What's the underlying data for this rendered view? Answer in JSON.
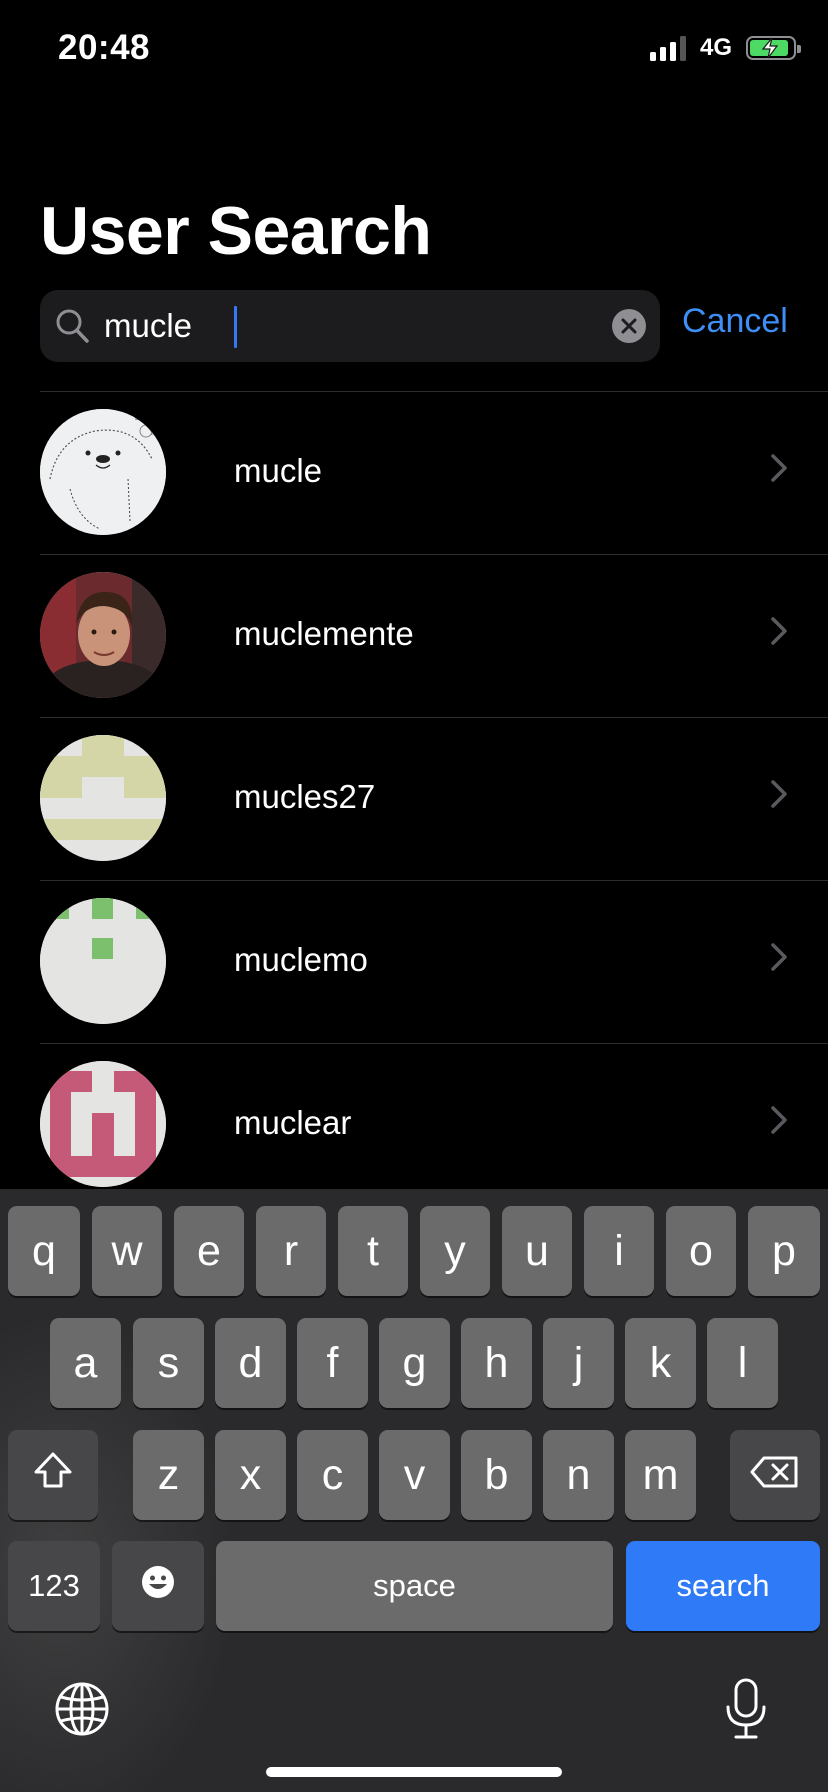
{
  "status_bar": {
    "time": "20:48",
    "network": "4G",
    "signal_icon": "cellular-signal-icon",
    "battery_icon": "battery-charging-icon"
  },
  "page": {
    "title": "User Search"
  },
  "search": {
    "value": "mucle",
    "cancel_label": "Cancel",
    "clear_icon": "clear-icon",
    "search_icon": "magnifier-icon"
  },
  "results": [
    {
      "username": "mucle",
      "avatar": "cartoon-bear-avatar"
    },
    {
      "username": "muclemente",
      "avatar": "photo-avatar"
    },
    {
      "username": "mucles27",
      "avatar": "identicon-olive"
    },
    {
      "username": "muclemo",
      "avatar": "identicon-green"
    },
    {
      "username": "muclear",
      "avatar": "identicon-rose"
    }
  ],
  "colors": {
    "accent": "#3e8ef7",
    "search_key": "#2f7af7",
    "battery_fill": "#4cd964"
  },
  "keyboard": {
    "row1": [
      "q",
      "w",
      "e",
      "r",
      "t",
      "y",
      "u",
      "i",
      "o",
      "p"
    ],
    "row2": [
      "a",
      "s",
      "d",
      "f",
      "g",
      "h",
      "j",
      "k",
      "l"
    ],
    "row3": [
      "z",
      "x",
      "c",
      "v",
      "b",
      "n",
      "m"
    ],
    "shift_icon": "shift-icon",
    "delete_icon": "delete-icon",
    "numbers_label": "123",
    "emoji_icon": "emoji-icon",
    "space_label": "space",
    "return_label": "search",
    "globe_icon": "globe-icon",
    "mic_icon": "microphone-icon"
  }
}
